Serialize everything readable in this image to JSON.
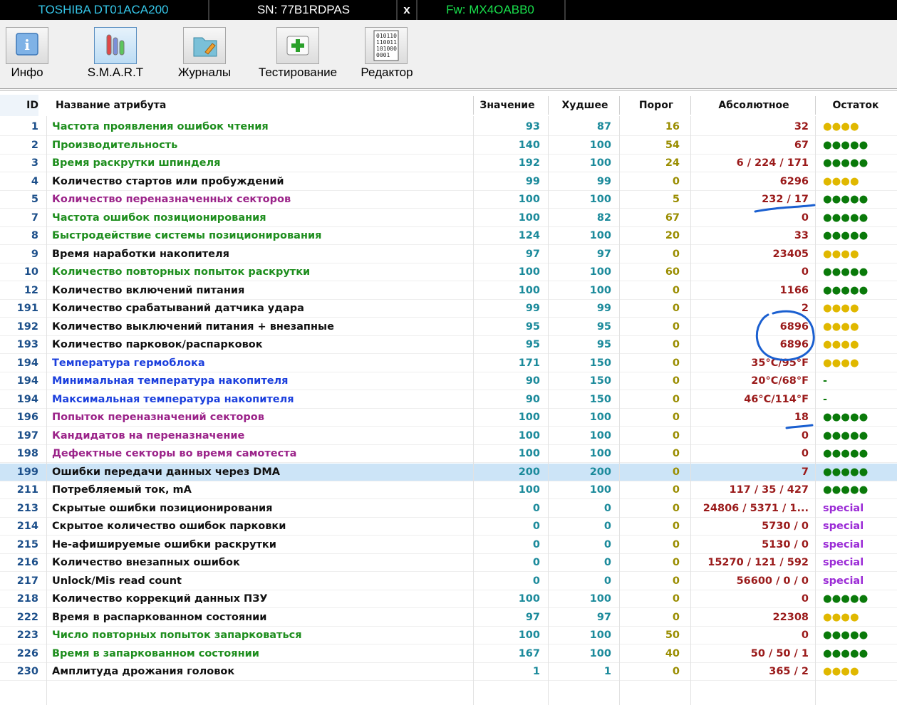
{
  "titlebar": {
    "model": "TOSHIBA DT01ACA200",
    "serial": "SN: 77B1RDPAS",
    "close": "x",
    "firmware": "Fw: MX4OABB0"
  },
  "toolbar": {
    "items": [
      {
        "label": "Инфо",
        "icon": "info-icon"
      },
      {
        "label": "S.M.A.R.T",
        "icon": "smart-tubes-icon"
      },
      {
        "label": "Журналы",
        "icon": "journal-folder-icon"
      },
      {
        "label": "Тестирование",
        "icon": "first-aid-kit-icon"
      },
      {
        "label": "Редактор",
        "icon": "binary-editor-icon"
      }
    ],
    "editor_icon_text": [
      "010110",
      "110011",
      "101000",
      "0001"
    ]
  },
  "colors": {
    "accent_select": "#cce4f7",
    "annotation": "#1a5fd0"
  },
  "table": {
    "headers": {
      "id": "ID",
      "name": "Название атрибута",
      "value": "Значение",
      "worst": "Худшее",
      "threshold": "Порог",
      "absolute": "Абсолютное",
      "remaining": "Остаток"
    },
    "rows": [
      {
        "id": "1",
        "name": "Частота проявления ошибок чтения",
        "value": "93",
        "worst": "87",
        "thr": "16",
        "abs": "32",
        "rem": "●●●●",
        "nameColor": "green",
        "remType": "y"
      },
      {
        "id": "2",
        "name": "Производительность",
        "value": "140",
        "worst": "100",
        "thr": "54",
        "abs": "67",
        "rem": "●●●●●",
        "nameColor": "green",
        "remType": "g"
      },
      {
        "id": "3",
        "name": "Время раскрутки шпинделя",
        "value": "192",
        "worst": "100",
        "thr": "24",
        "abs": "6 / 224 / 171",
        "rem": "●●●●●",
        "nameColor": "green",
        "remType": "g"
      },
      {
        "id": "4",
        "name": "Количество стартов или пробуждений",
        "value": "99",
        "worst": "99",
        "thr": "0",
        "abs": "6296",
        "rem": "●●●●",
        "nameColor": "black",
        "remType": "y"
      },
      {
        "id": "5",
        "name": "Количество переназначенных секторов",
        "value": "100",
        "worst": "100",
        "thr": "5",
        "abs": "232 / 17",
        "rem": "●●●●●",
        "nameColor": "purple",
        "remType": "g",
        "absColor": "red"
      },
      {
        "id": "7",
        "name": "Частота ошибок позиционирования",
        "value": "100",
        "worst": "82",
        "thr": "67",
        "abs": "0",
        "rem": "●●●●●",
        "nameColor": "green",
        "remType": "g"
      },
      {
        "id": "8",
        "name": "Быстродействие системы позиционирования",
        "value": "124",
        "worst": "100",
        "thr": "20",
        "abs": "33",
        "rem": "●●●●●",
        "nameColor": "green",
        "remType": "g"
      },
      {
        "id": "9",
        "name": "Время наработки накопителя",
        "value": "97",
        "worst": "97",
        "thr": "0",
        "abs": "23405",
        "rem": "●●●●",
        "nameColor": "black",
        "remType": "y"
      },
      {
        "id": "10",
        "name": "Количество повторных попыток раскрутки",
        "value": "100",
        "worst": "100",
        "thr": "60",
        "abs": "0",
        "rem": "●●●●●",
        "nameColor": "green",
        "remType": "g"
      },
      {
        "id": "12",
        "name": "Количество включений питания",
        "value": "100",
        "worst": "100",
        "thr": "0",
        "abs": "1166",
        "rem": "●●●●●",
        "nameColor": "black",
        "remType": "g"
      },
      {
        "id": "191",
        "name": "Количество срабатываний датчика удара",
        "value": "99",
        "worst": "99",
        "thr": "0",
        "abs": "2",
        "rem": "●●●●",
        "nameColor": "black",
        "remType": "y",
        "absColor": "red"
      },
      {
        "id": "192",
        "name": "Количество выключений питания + внезапные",
        "value": "95",
        "worst": "95",
        "thr": "0",
        "abs": "6896",
        "rem": "●●●●",
        "nameColor": "black",
        "remType": "y"
      },
      {
        "id": "193",
        "name": "Количество парковок/распарковок",
        "value": "95",
        "worst": "95",
        "thr": "0",
        "abs": "6896",
        "rem": "●●●●",
        "nameColor": "black",
        "remType": "y"
      },
      {
        "id": "194",
        "name": "Температура гермоблока",
        "value": "171",
        "worst": "150",
        "thr": "0",
        "abs": "35°C/95°F",
        "rem": "●●●●",
        "nameColor": "blue",
        "remType": "y",
        "absColor": "blue"
      },
      {
        "id": "194",
        "name": "Минимальная температура накопителя",
        "value": "90",
        "worst": "150",
        "thr": "0",
        "abs": "20°C/68°F",
        "rem": "-",
        "nameColor": "blue",
        "remType": "dash",
        "absColor": "blue"
      },
      {
        "id": "194",
        "name": "Максимальная температура накопителя",
        "value": "90",
        "worst": "150",
        "thr": "0",
        "abs": "46°C/114°F",
        "rem": "-",
        "nameColor": "blue",
        "remType": "dash",
        "absColor": "blue"
      },
      {
        "id": "196",
        "name": "Попыток переназначений секторов",
        "value": "100",
        "worst": "100",
        "thr": "0",
        "abs": "18",
        "rem": "●●●●●",
        "nameColor": "purple",
        "remType": "g",
        "absColor": "red"
      },
      {
        "id": "197",
        "name": "Кандидатов на переназначение",
        "value": "100",
        "worst": "100",
        "thr": "0",
        "abs": "0",
        "rem": "●●●●●",
        "nameColor": "purple",
        "remType": "g",
        "absColor": "green"
      },
      {
        "id": "198",
        "name": "Дефектные секторы во время самотеста",
        "value": "100",
        "worst": "100",
        "thr": "0",
        "abs": "0",
        "rem": "●●●●●",
        "nameColor": "purple",
        "remType": "g",
        "absColor": "green"
      },
      {
        "id": "199",
        "name": "Ошибки передачи данных через DMA",
        "value": "200",
        "worst": "200",
        "thr": "0",
        "abs": "7",
        "rem": "●●●●●",
        "nameColor": "black",
        "remType": "g",
        "absColor": "red",
        "selected": true
      },
      {
        "id": "211",
        "name": "Потребляемый ток, mA",
        "value": "100",
        "worst": "100",
        "thr": "0",
        "abs": "117 / 35 / 427",
        "rem": "●●●●●",
        "nameColor": "black",
        "remType": "g"
      },
      {
        "id": "213",
        "name": "Скрытые ошибки позиционирования",
        "value": "0",
        "worst": "0",
        "thr": "0",
        "abs": "24806 / 5371 / 1...",
        "rem": "special",
        "nameColor": "black",
        "remType": "special"
      },
      {
        "id": "214",
        "name": "Скрытое количество ошибок парковки",
        "value": "0",
        "worst": "0",
        "thr": "0",
        "abs": "5730 / 0",
        "rem": "special",
        "nameColor": "black",
        "remType": "special"
      },
      {
        "id": "215",
        "name": "Не-афишируемые ошибки раскрутки",
        "value": "0",
        "worst": "0",
        "thr": "0",
        "abs": "5130 / 0",
        "rem": "special",
        "nameColor": "black",
        "remType": "special"
      },
      {
        "id": "216",
        "name": "Количество внезапных ошибок",
        "value": "0",
        "worst": "0",
        "thr": "0",
        "abs": "15270 / 121 / 592",
        "rem": "special",
        "nameColor": "black",
        "remType": "special"
      },
      {
        "id": "217",
        "name": "Unlock/Mis read count",
        "value": "0",
        "worst": "0",
        "thr": "0",
        "abs": "56600 / 0 / 0",
        "rem": "special",
        "nameColor": "black",
        "remType": "special"
      },
      {
        "id": "218",
        "name": "Количество коррекций данных ПЗУ",
        "value": "100",
        "worst": "100",
        "thr": "0",
        "abs": "0",
        "rem": "●●●●●",
        "nameColor": "black",
        "remType": "g"
      },
      {
        "id": "222",
        "name": "Время в распаркованном состоянии",
        "value": "97",
        "worst": "97",
        "thr": "0",
        "abs": "22308",
        "rem": "●●●●",
        "nameColor": "black",
        "remType": "y"
      },
      {
        "id": "223",
        "name": "Число повторных попыток запарковаться",
        "value": "100",
        "worst": "100",
        "thr": "50",
        "abs": "0",
        "rem": "●●●●●",
        "nameColor": "green",
        "remType": "g",
        "absColor": "green"
      },
      {
        "id": "226",
        "name": "Время в запаркованном состоянии",
        "value": "167",
        "worst": "100",
        "thr": "40",
        "abs": "50 / 50 / 1",
        "rem": "●●●●●",
        "nameColor": "green",
        "remType": "g"
      },
      {
        "id": "230",
        "name": "Амплитуда дрожания головок",
        "value": "1",
        "worst": "1",
        "thr": "0",
        "abs": "365 / 2",
        "rem": "●●●●",
        "nameColor": "black",
        "remType": "y"
      }
    ]
  }
}
